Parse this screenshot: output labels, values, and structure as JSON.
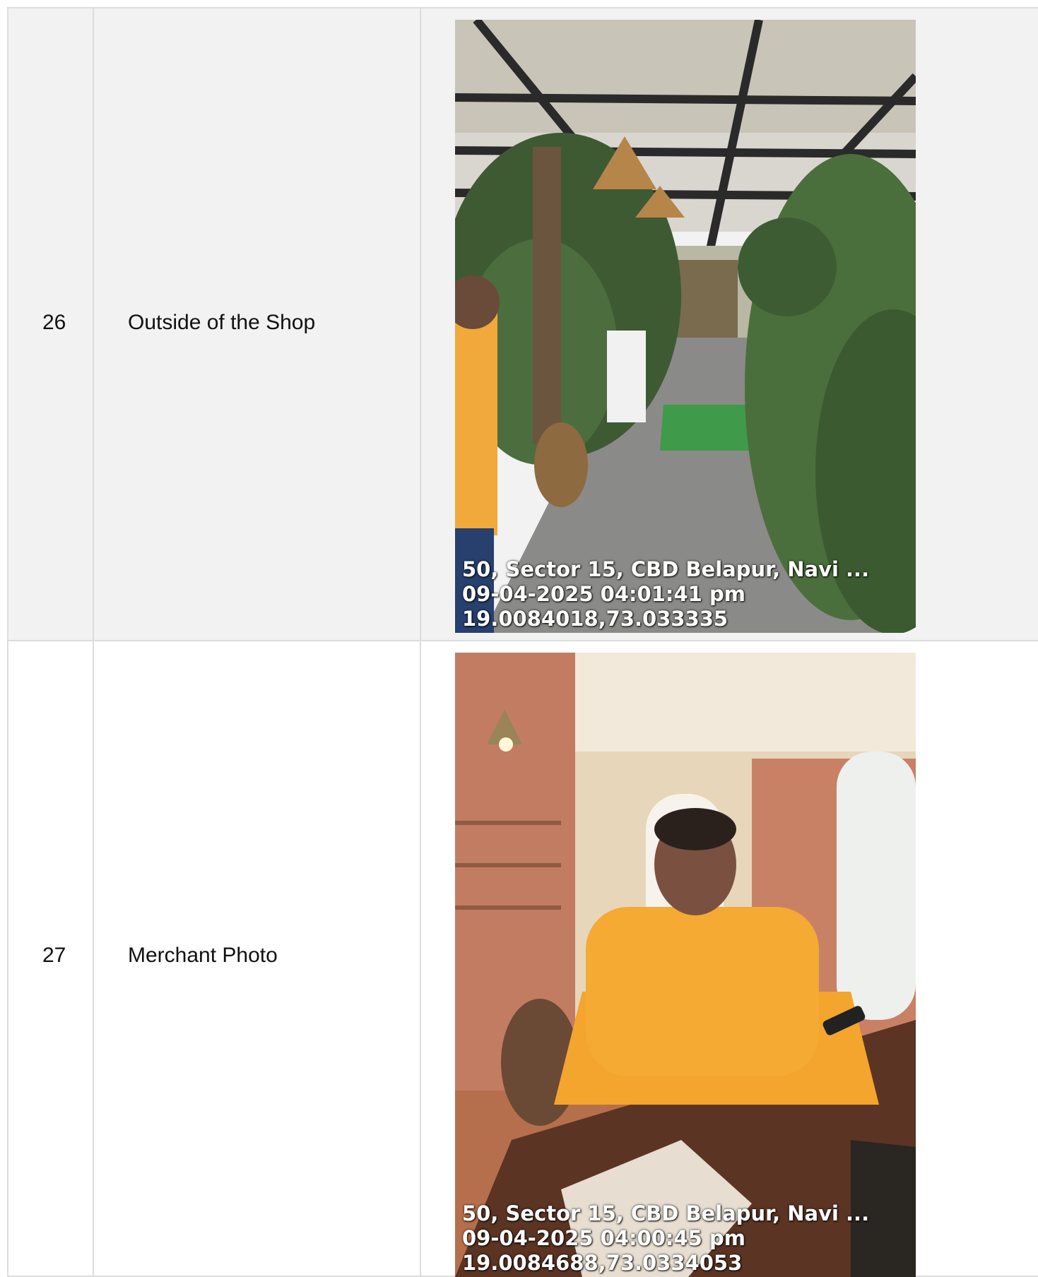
{
  "rows": [
    {
      "number": "26",
      "label": "Outside of the Shop",
      "photo": {
        "subject": "cafe-entrance-with-plants",
        "stamp": {
          "address": "50, Sector 15, CBD Belapur, Navi ...",
          "datetime": "09-04-2025 04:01:41 pm",
          "coords": "19.0084018,73.033335"
        }
      }
    },
    {
      "number": "27",
      "label": "Merchant Photo",
      "photo": {
        "subject": "merchant-seated-at-table",
        "stamp": {
          "address": "50, Sector 15, CBD Belapur, Navi ...",
          "datetime": "09-04-2025 04:00:45 pm",
          "coords": "19.0084688,73.0334053"
        }
      }
    }
  ]
}
